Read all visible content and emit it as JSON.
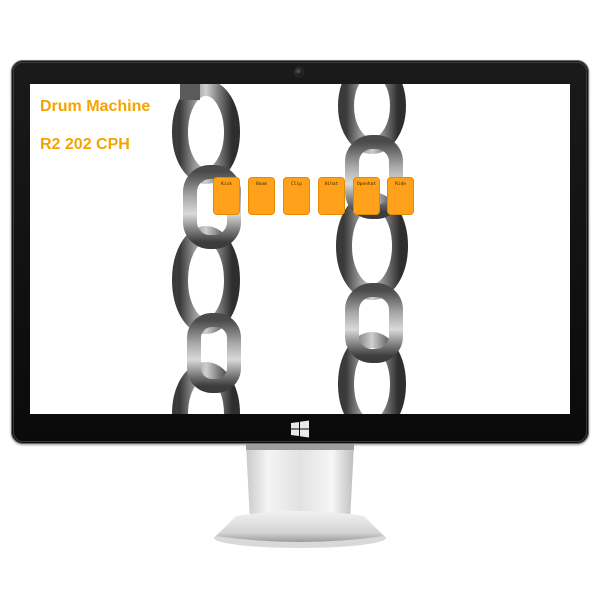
{
  "screen": {
    "title_line1": "Drum Machine",
    "title_line2": "R2 202 CPH",
    "accent_color": "#f5a300",
    "pad_color": "#ffa11a",
    "background_image": "steel-chains-image"
  },
  "pads": [
    {
      "label": "Kick"
    },
    {
      "label": "Boom"
    },
    {
      "label": "Clip"
    },
    {
      "label": "Hihat"
    },
    {
      "label": "Openhat"
    },
    {
      "label": "Ride"
    }
  ],
  "monitor": {
    "os_logo": "windows-logo-icon",
    "camera": "webcam-icon"
  }
}
